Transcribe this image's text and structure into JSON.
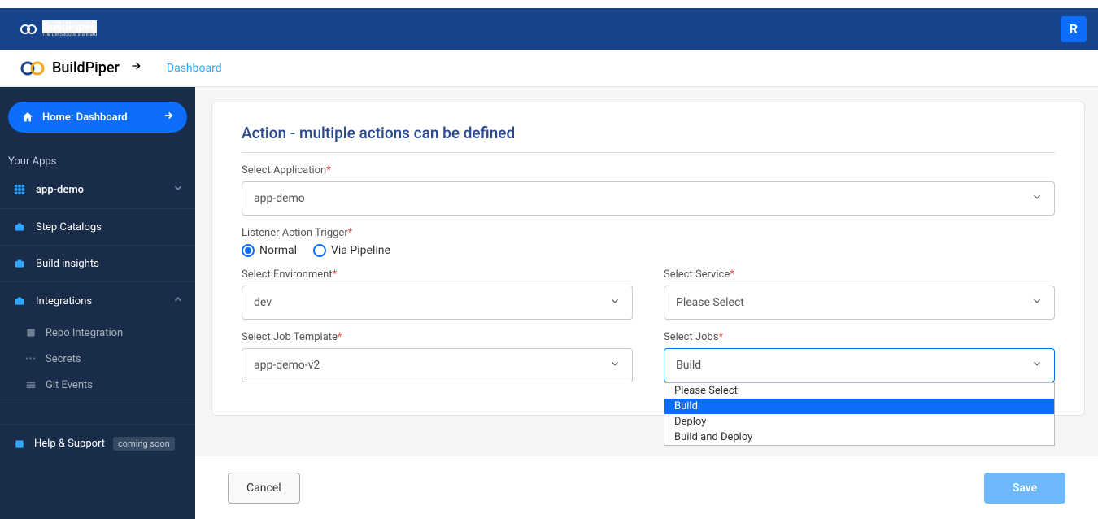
{
  "topbar": {
    "brand_main": "BuildPiper",
    "brand_sub": "The DevSecOps standard",
    "user_initial": "R"
  },
  "secondbar": {
    "brand": "BuildPiper",
    "link": "Dashboard"
  },
  "sidebar": {
    "home_label": "Home: Dashboard",
    "your_apps_label": "Your Apps",
    "app_item": "app-demo",
    "step_catalogs": "Step Catalogs",
    "build_insights": "Build insights",
    "integrations": "Integrations",
    "integrations_sub": {
      "repo": "Repo Integration",
      "secrets": "Secrets",
      "git": "Git Events"
    },
    "help_label": "Help & Support",
    "help_badge": "coming soon"
  },
  "form": {
    "title": "Action - multiple actions can be defined",
    "labels": {
      "app": "Select Application",
      "trigger": "Listener Action Trigger",
      "env": "Select Environment",
      "service": "Select Service",
      "job_template": "Select Job Template",
      "jobs": "Select Jobs"
    },
    "required": "*",
    "values": {
      "app": "app-demo",
      "env": "dev",
      "service": "Please Select",
      "job_template": "app-demo-v2",
      "jobs": "Build"
    },
    "radios": {
      "normal": "Normal",
      "pipeline": "Via Pipeline"
    },
    "jobs_options": {
      "please": "Please Select",
      "build": "Build",
      "deploy": "Deploy",
      "build_deploy": "Build and Deploy"
    }
  },
  "footer": {
    "cancel": "Cancel",
    "save": "Save"
  },
  "colors": {
    "primary": "#0d6efd",
    "header": "#164389",
    "sidebar": "#192d4a"
  }
}
